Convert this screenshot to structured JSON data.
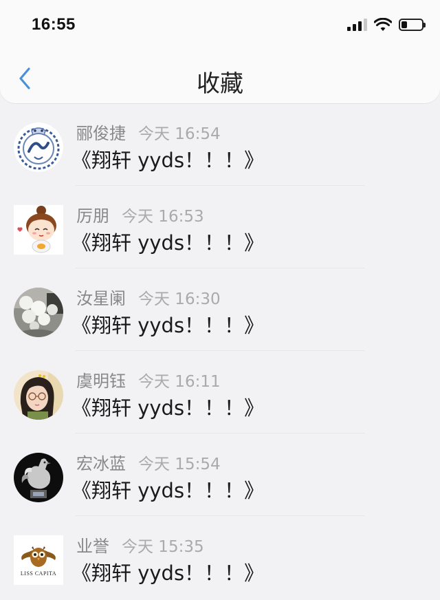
{
  "status_bar": {
    "time": "16:55",
    "icons": [
      "cellular-signal-icon",
      "wifi-icon",
      "battery-icon"
    ]
  },
  "nav": {
    "title": "收藏",
    "back_icon": "chevron-left-icon",
    "accent_color": "#4a90d9"
  },
  "list": {
    "items": [
      {
        "name": "郦俊捷",
        "time": "今天 16:54",
        "message": "《翔轩 yyds！！！》",
        "avatar": "blue-porcelain-logo"
      },
      {
        "name": "厉朋",
        "time": "今天 16:53",
        "message": "《翔轩 yyds！！！》",
        "avatar": "cartoon-girl"
      },
      {
        "name": "汝星阑",
        "time": "今天 16:30",
        "message": "《翔轩 yyds！！！》",
        "avatar": "white-flowers"
      },
      {
        "name": "虞明钰",
        "time": "今天 16:11",
        "message": "《翔轩 yyds！！！》",
        "avatar": "girl-with-glasses"
      },
      {
        "name": "宏冰蓝",
        "time": "今天 15:54",
        "message": "《翔轩 yyds！！！》",
        "avatar": "silver-rooster"
      },
      {
        "name": "业誉",
        "time": "今天 15:35",
        "message": "《翔轩 yyds！！！》",
        "avatar": "owl-bliss-capital-logo",
        "avatar_text": "LISS CAPITA"
      }
    ]
  }
}
